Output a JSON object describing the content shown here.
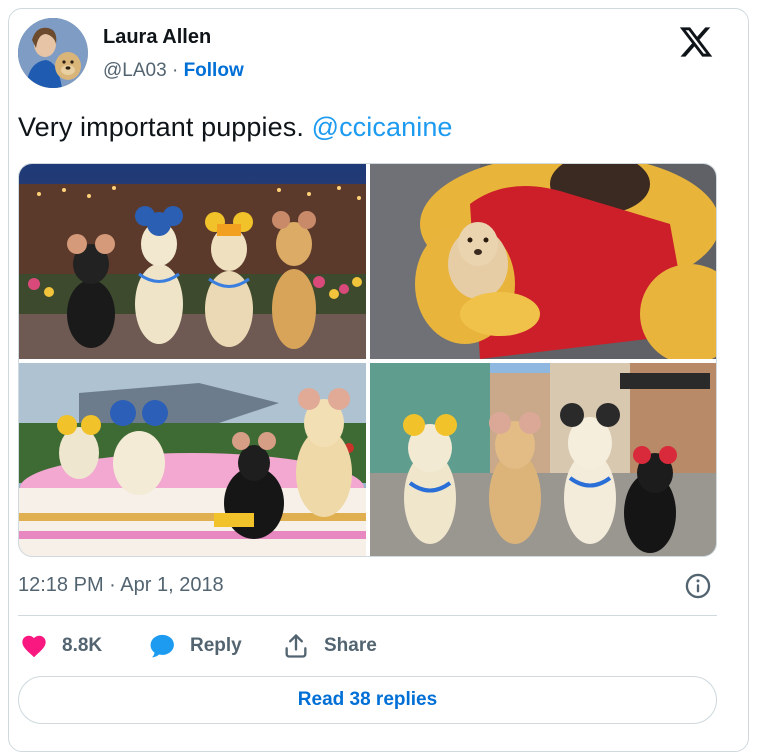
{
  "author": {
    "name": "Laura Allen",
    "handle": "@LA03",
    "separator": "·",
    "follow_label": "Follow"
  },
  "tweet": {
    "text": "Very important puppies.",
    "mention": "@ccicanine"
  },
  "media": [
    {
      "name": "photo-dogs-main-street-night",
      "icon": "photo"
    },
    {
      "name": "photo-puppy-with-winnie-the-pooh",
      "icon": "photo"
    },
    {
      "name": "photo-dogs-in-teacup-ride",
      "icon": "photo"
    },
    {
      "name": "photo-dogs-on-street-with-ears",
      "icon": "photo"
    }
  ],
  "meta": {
    "timestamp": "12:18 PM · Apr 1, 2018"
  },
  "actions": {
    "like_count": "8.8K",
    "reply_label": "Reply",
    "share_label": "Share"
  },
  "footer": {
    "read_replies_label": "Read 38 replies"
  },
  "colors": {
    "accent": "#1d9bf0",
    "link_dark": "#006fd6",
    "heart": "#f91880",
    "muted": "#536471",
    "border": "#cfd9de"
  },
  "icons": [
    "x-logo-icon",
    "info-icon",
    "heart-icon",
    "reply-bubble-icon",
    "share-icon"
  ]
}
